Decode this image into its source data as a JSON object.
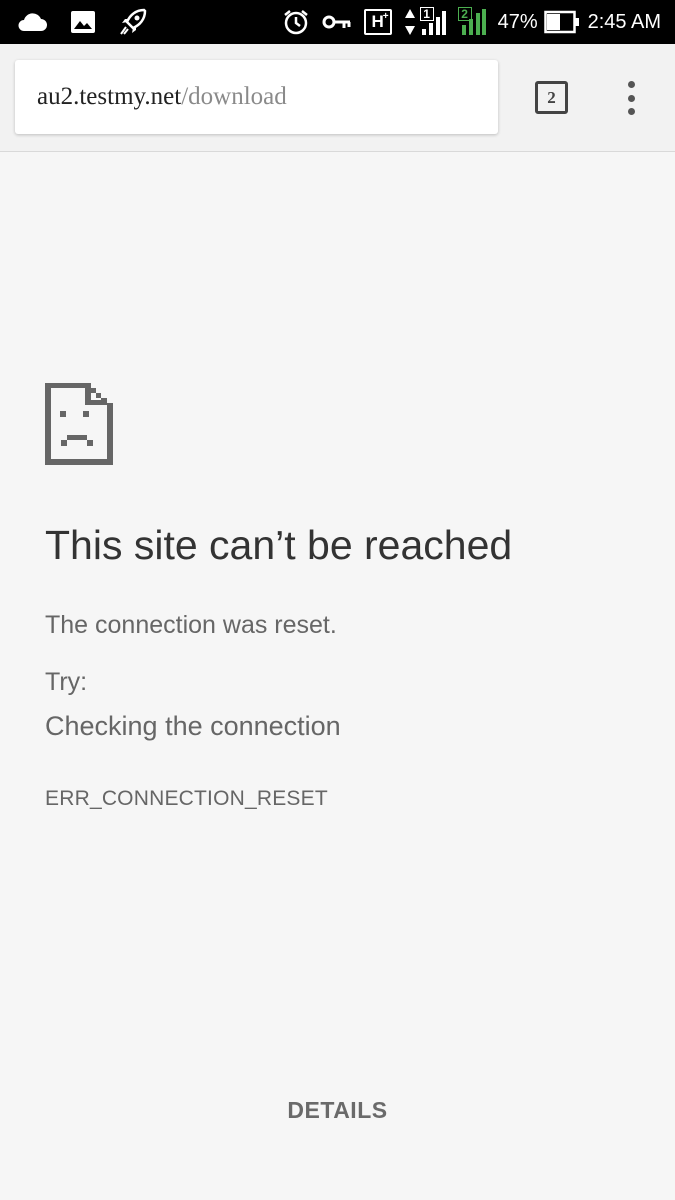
{
  "status_bar": {
    "left_icons": [
      "cloud-icon",
      "image-icon",
      "rocket-icon"
    ],
    "right_icons": [
      "alarm-icon",
      "vpn-key-icon",
      "h-plus-network-icon",
      "signal-sim1-icon",
      "signal-sim2-icon",
      "battery-icon"
    ],
    "network_type": "H",
    "sim1_badge": "1",
    "sim2_badge": "2",
    "sim2_color": "#4caf50",
    "battery_percent": "47%",
    "time": "2:45 AM"
  },
  "toolbar": {
    "url_host": "au2.testmy.net",
    "url_path": "/download",
    "tab_count": "2",
    "menu_icon": "more-vert-icon"
  },
  "error": {
    "icon": "sad-page-icon",
    "title": "This site can’t be reached",
    "description": "The connection was reset.",
    "try_label": "Try:",
    "suggestion": "Checking the connection",
    "code": "ERR_CONNECTION_RESET"
  },
  "footer": {
    "details_label": "DETAILS"
  }
}
